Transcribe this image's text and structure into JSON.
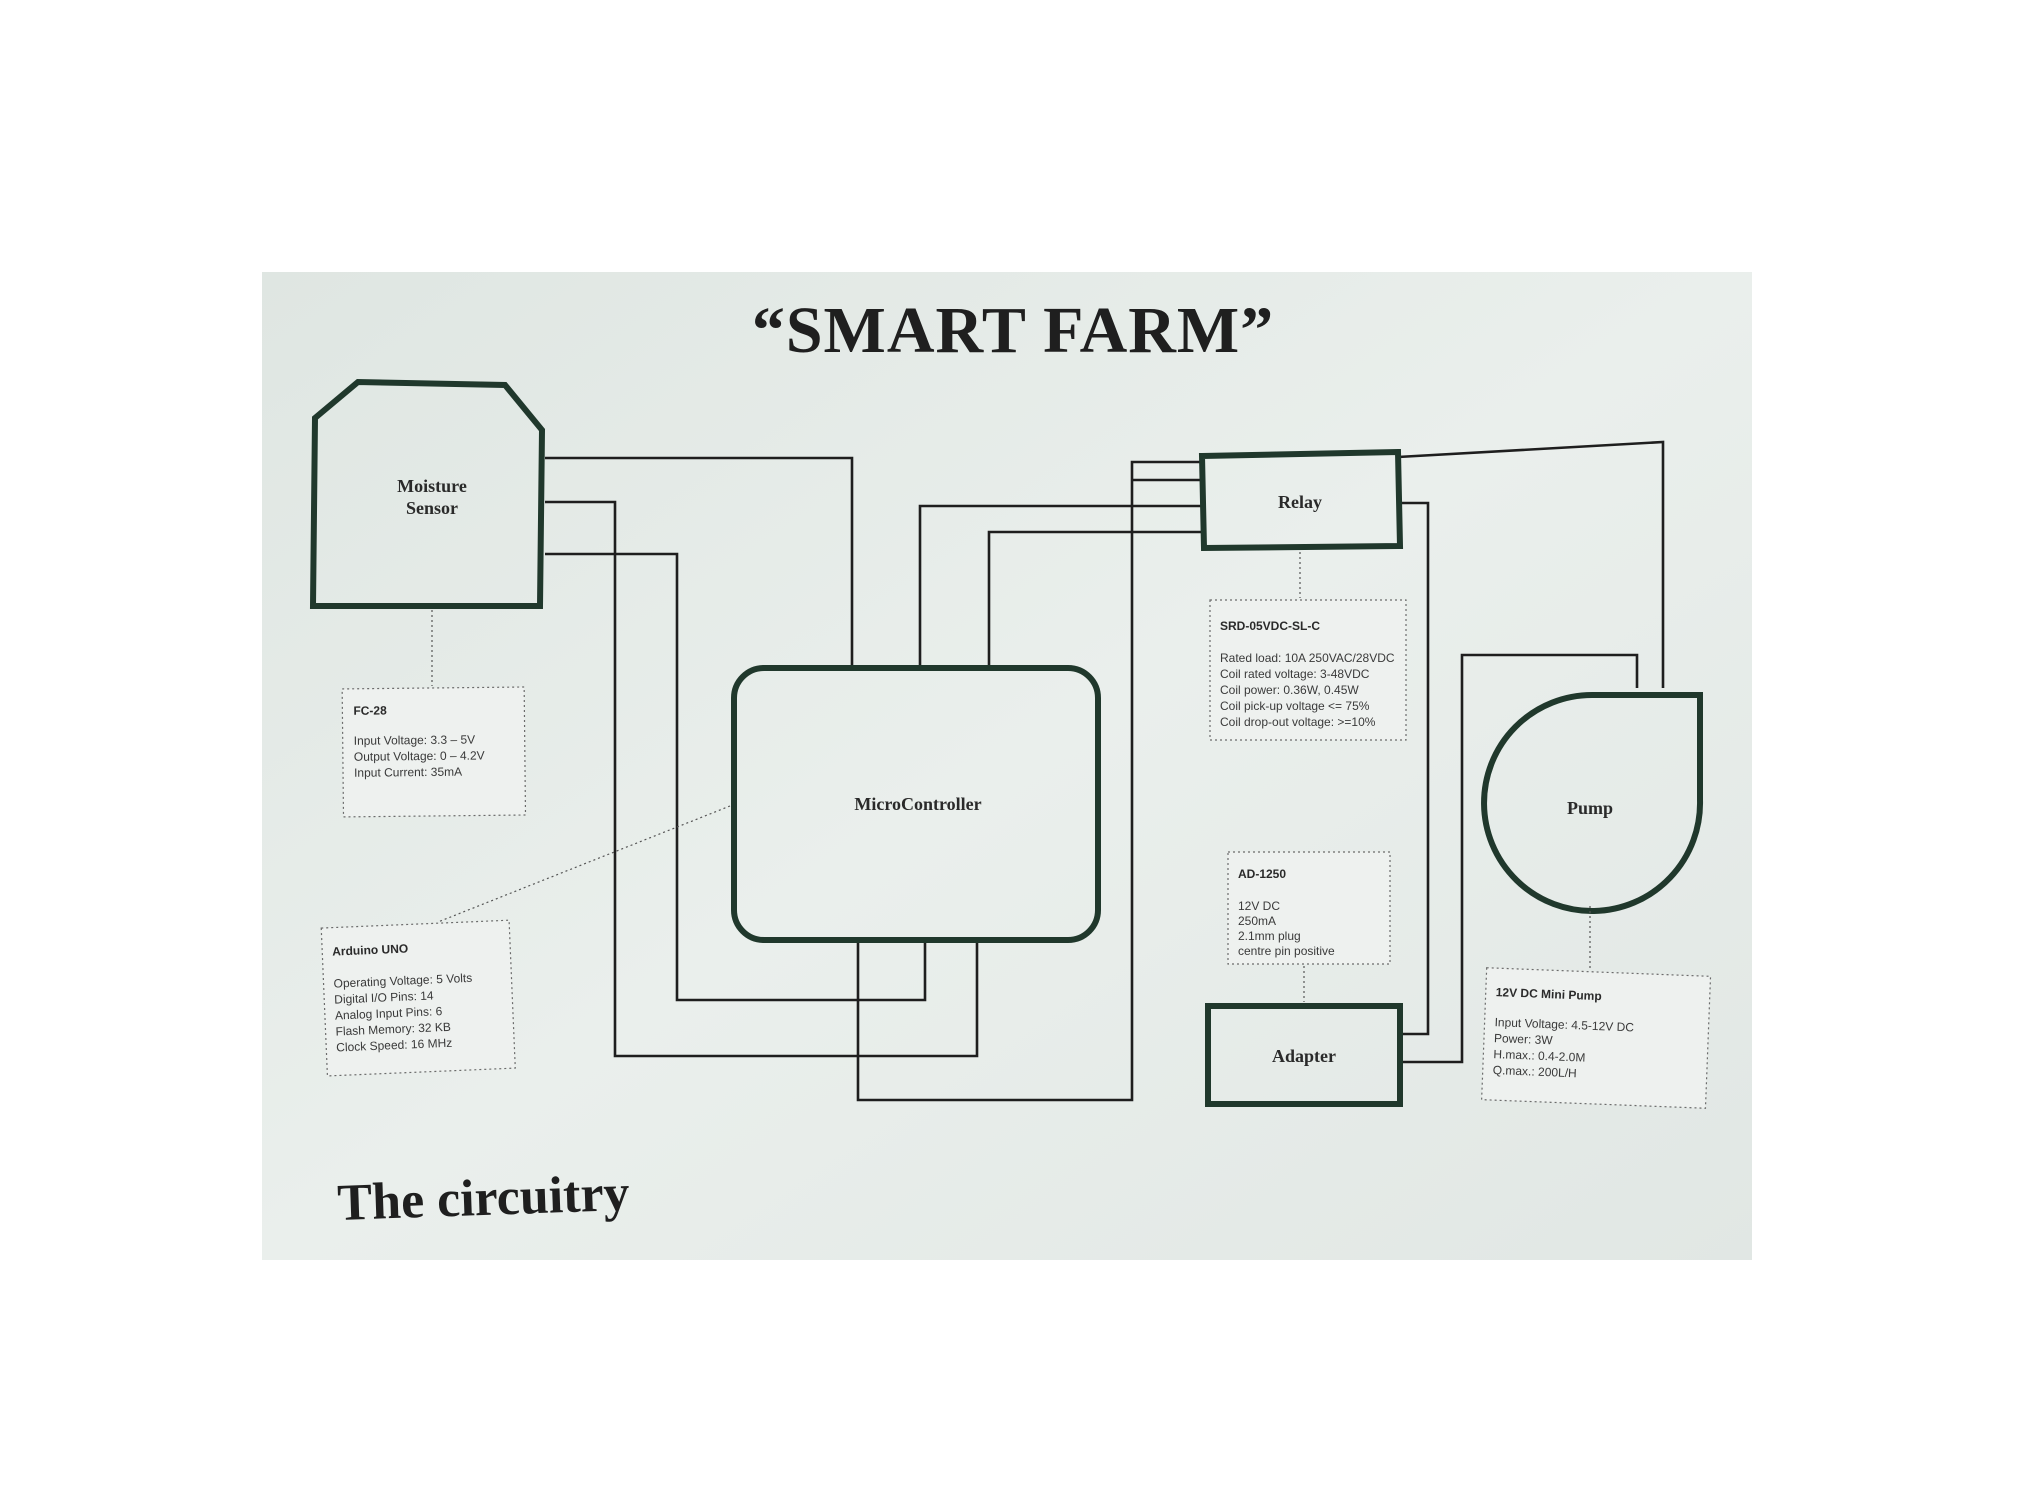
{
  "title": "“SMART FARM”",
  "footer": "The circuitry",
  "blocks": {
    "moisture_sensor": {
      "line1": "Moisture",
      "line2": "Sensor"
    },
    "microcontroller": {
      "label": "MicroController"
    },
    "relay": {
      "label": "Relay"
    },
    "pump": {
      "label": "Pump"
    },
    "adapter": {
      "label": "Adapter"
    }
  },
  "specs": {
    "fc28": {
      "title": "FC-28",
      "lines": [
        "Input Voltage: 3.3 – 5V",
        "Output Voltage: 0 – 4.2V",
        "Input Current: 35mA"
      ]
    },
    "arduino": {
      "title": "Arduino UNO",
      "lines": [
        "Operating Voltage: 5 Volts",
        "Digital I/O Pins: 14",
        "Analog Input Pins: 6",
        "Flash Memory: 32 KB",
        "Clock Speed: 16 MHz"
      ]
    },
    "relay": {
      "title": "SRD-05VDC-SL-C",
      "lines": [
        "Rated load: 10A 250VAC/28VDC",
        "Coil rated voltage: 3-48VDC",
        "Coil power: 0.36W, 0.45W",
        "Coil pick-up voltage  <= 75%",
        "Coil drop-out voltage: >=10%"
      ]
    },
    "adapter": {
      "title": "AD-1250",
      "lines": [
        "12V DC",
        "250mA",
        "2.1mm plug",
        "centre pin positive"
      ]
    },
    "pump": {
      "title": "12V DC Mini Pump",
      "lines": [
        "Input Voltage: 4.5-12V DC",
        "Power: 3W",
        "H.max.: 0.4-2.0M",
        "Q.max.: 200L/H"
      ]
    }
  },
  "colors": {
    "block_stroke": "#20382c",
    "paper": "#e6ebe8",
    "ink": "#1e1e1e"
  }
}
